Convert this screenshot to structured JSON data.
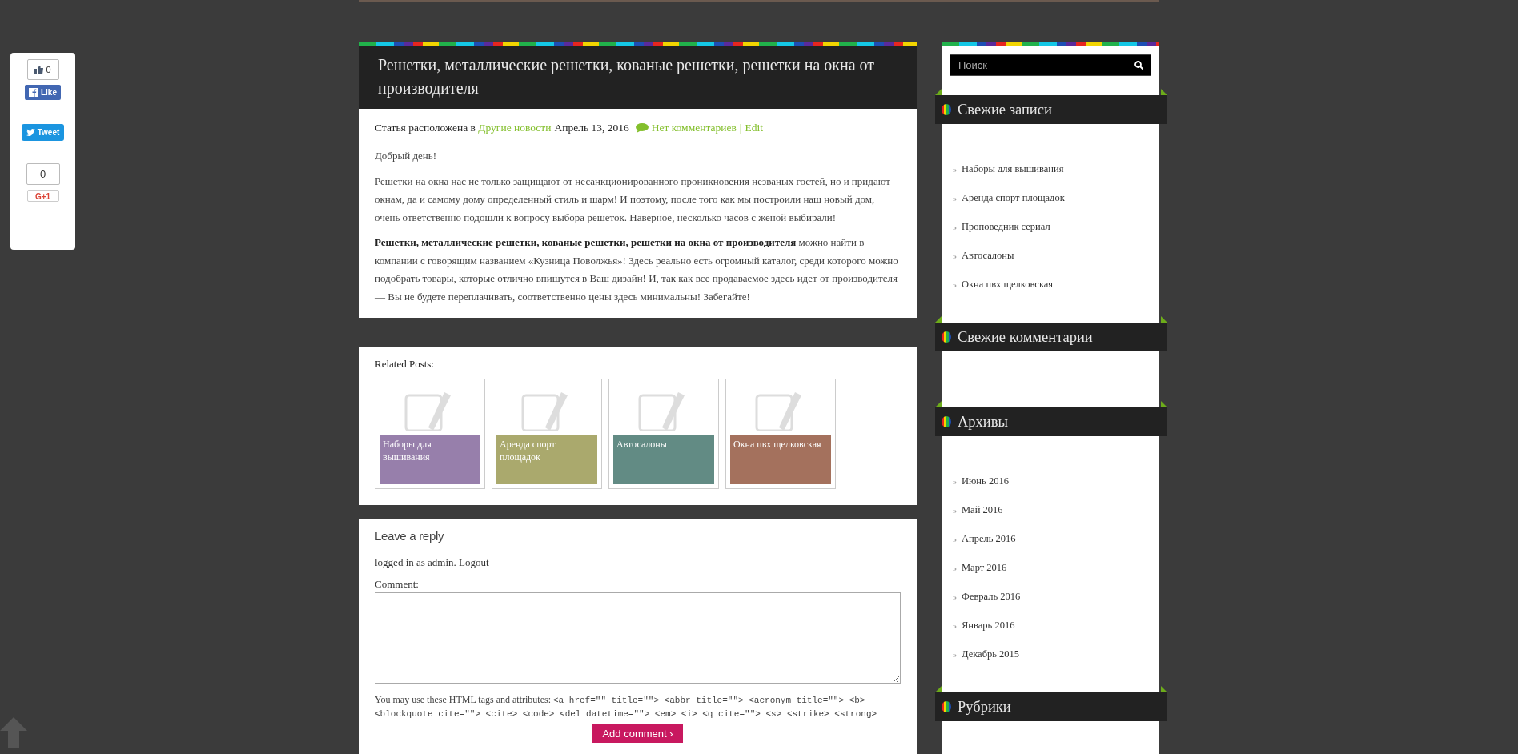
{
  "share_widget": {
    "like_count": "0",
    "like_label": "Like",
    "tweet_label": "Tweet",
    "plus_count": "0",
    "plus_label": "G+1"
  },
  "post": {
    "title": "Решетки, металлические решетки, кованые решетки, решетки на окна от производителя",
    "meta": {
      "prefix": "Статья расположена в",
      "category": "Другие новости",
      "date": "Апрель 13, 2016",
      "comments": "Нет комментариев",
      "separator": "|",
      "edit": "Edit"
    },
    "paragraphs": [
      "Добрый день!",
      "Решетки на окна нас не только защищают от несанкционированного проникновения незваных гостей, но и придают окнам, да и самому дому определенный стиль и шарм! И поэтому, после того как мы построили наш новый дом, очень ответственно подошли к вопросу выбора решеток. Наверное, несколько часов с женой выбирали!",
      "**Решетки, металлические решетки, кованые решетки, решетки на окна от производителя** можно найти в компании с говорящим названием «Кузница Поволжья»! Здесь реально есть огромный каталог, среди которого можно подобрать товары, которые отлично впишутся в Ваш дизайн! И, так как все продаваемое здесь идет от производителя — Вы не будете переплачивать, соответственно цены здесь минимальны! Забегайте!"
    ]
  },
  "related": {
    "heading": "Related Posts:",
    "items": [
      {
        "title": "Наборы для вышивания",
        "color": "#977fab"
      },
      {
        "title": "Аренда спорт площадок",
        "color": "#aaa96d"
      },
      {
        "title": "Автосалоны",
        "color": "#628b84"
      },
      {
        "title": "Окна пвх щелковская",
        "color": "#a4715d"
      }
    ]
  },
  "reply": {
    "heading": "Leave a reply",
    "logged_in": "logged in as admin.",
    "logout": "Logout",
    "comment_label": "Comment:",
    "tags_intro": "You may use these HTML tags and attributes:",
    "tags": "<a href=\"\" title=\"\"> <abbr title=\"\"> <acronym title=\"\"> <b> <blockquote cite=\"\"> <cite> <code> <del datetime=\"\"> <em> <i> <q cite=\"\"> <s> <strike> <strong>",
    "submit": "Add comment ›"
  },
  "sidebar": {
    "search": {
      "placeholder": "Поиск"
    },
    "widgets": [
      {
        "title": "Свежие записи",
        "bullet": "»",
        "items": [
          "Наборы для вышивания",
          "Аренда спорт площадок",
          "Проповедник сериал",
          "Автосалоны",
          "Окна пвх щелковская"
        ]
      },
      {
        "title": "Свежие комментарии"
      },
      {
        "title": "Архивы",
        "bullet": "»",
        "items": [
          "Июнь 2016",
          "Май 2016",
          "Апрель 2016",
          "Март 2016",
          "Февраль 2016",
          "Январь 2016",
          "Декабрь 2015"
        ]
      },
      {
        "title": "Рубрики"
      }
    ]
  }
}
